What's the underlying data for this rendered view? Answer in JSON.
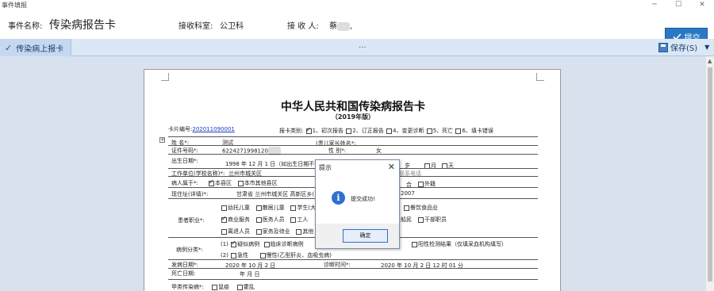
{
  "window": {
    "title": "事件填报",
    "controls": [
      "─",
      "☐",
      "✕"
    ]
  },
  "info": {
    "event_label": "事件名称:",
    "event_value": "传染病报告卡",
    "dept_label": "接收科室:",
    "dept_value": "公卫科",
    "receiver_label": "接 收 人:",
    "receiver_value": "蔡",
    "receiver_suffix": ","
  },
  "toolbar": {
    "submit_label": "提交",
    "save_label": "保存(S)",
    "dots": "...",
    "tab_label": "传染病上报卡"
  },
  "document": {
    "title": "中华人民共和国传染病报告卡",
    "subtitle": "（2019年版）",
    "card_no_label": "卡片编号:",
    "card_no": "202011090001",
    "report_type_label": "报卡类别:",
    "report_types": [
      "1、初次报告",
      "2、订正报告",
      "4、变更诊断",
      "5、死亡",
      "6、填卡错误"
    ],
    "name_label": "姓    名*:",
    "name_value": "测试",
    "parent_label": "(患儿家长姓名*:",
    "id_label": "证件号码*:",
    "id_value": "6224271998120",
    "gender_label": "性    别*:",
    "gender_value": "女",
    "dob_label": "出生日期*:",
    "dob_value": "1998  年 12 月  1  日（如出生日期不详",
    "age_unit_year": "岁",
    "age_unit_month": "月",
    "age_unit_day": "天",
    "workplace_label": "工作单位(学校名称)*:",
    "workplace_value": "兰州市城关区",
    "contact_label": "联系电话",
    "belong_label": "病人属于*:",
    "belong_options": [
      "本县区",
      "本市其他县区"
    ],
    "belong_other": "合",
    "belong_abroad": "外籍",
    "address_label": "现住址(详填)*:",
    "address_value": "甘肃省 兰州市城关区 高新区乡(",
    "address_tail": "2007",
    "occupation_label": "患者职业*:",
    "occupation_row1": [
      "幼托儿童",
      "散居儿童",
      "学生(大"
    ],
    "occupation_row1_tail": "餐饮食品业",
    "occupation_row2": [
      "商业服务",
      "医务人员",
      "工人"
    ],
    "occupation_row2_tail": "干部职员",
    "occupation_row2_mid": "船民",
    "occupation_row3": [
      "离退人员",
      "家务及待业",
      "其他"
    ],
    "case_class_label": "病例分类*:",
    "case_class_1": [
      "(1)",
      "疑似病例",
      "临床诊断病例"
    ],
    "case_class_1_tail": "阳性检测结果（仅填采血机构填写）",
    "case_class_2": [
      "(2)",
      "急性",
      "慢性(乙型肝炎、血吸虫病)"
    ],
    "onset_label": "发病日期*:",
    "onset_value": "2020   年   10   月   2   日",
    "diag_label": "诊断时间*:",
    "diag_value": "2020   年   10   月   2   日   12   时   01   分",
    "death_label": "死亡日期:",
    "death_value": "年       月       日",
    "notifiable_label": "甲类传染病*:",
    "notifiable_options": [
      "鼠疫",
      "霍乱"
    ]
  },
  "dialog": {
    "title": "提示",
    "message": "提交成功!",
    "ok_label": "确定",
    "close": "✕",
    "icon": "info-icon"
  }
}
